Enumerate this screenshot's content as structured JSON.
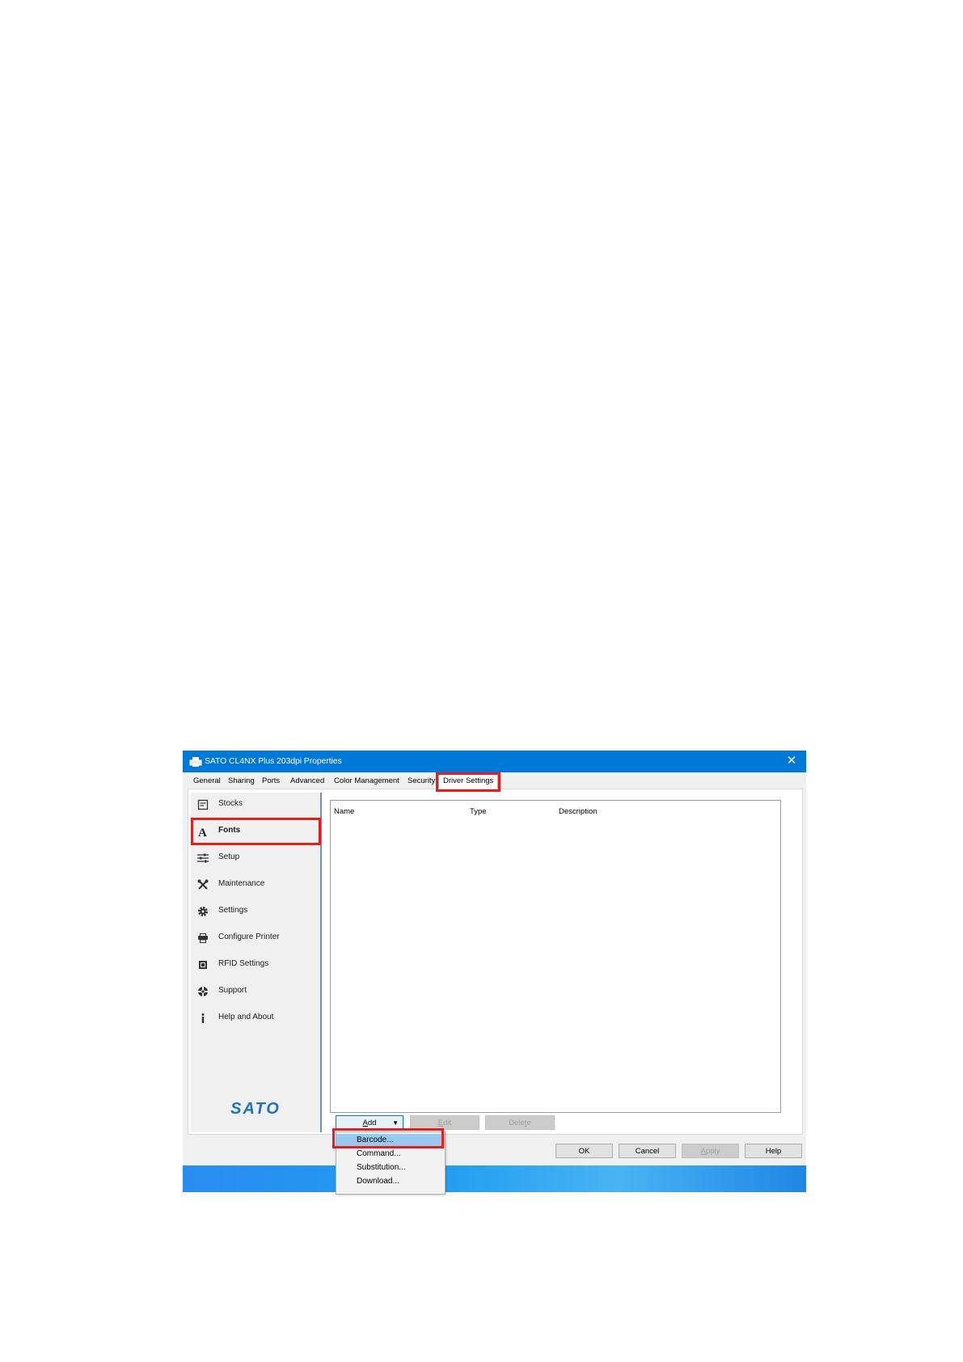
{
  "window": {
    "title": "SATO CL4NX Plus 203dpi Properties",
    "close_glyph": "✕"
  },
  "tabs": [
    "General",
    "Sharing",
    "Ports",
    "Advanced",
    "Color Management",
    "Security",
    "Driver Settings"
  ],
  "active_tab": "Driver Settings",
  "sidebar": {
    "items": [
      {
        "label": "Stocks",
        "icon": "stocks-icon"
      },
      {
        "label": "Fonts",
        "icon": "font-icon"
      },
      {
        "label": "Setup",
        "icon": "sliders-icon"
      },
      {
        "label": "Maintenance",
        "icon": "tools-icon"
      },
      {
        "label": "Settings",
        "icon": "gear-icon"
      },
      {
        "label": "Configure Printer",
        "icon": "printer-config-icon"
      },
      {
        "label": "RFID Settings",
        "icon": "rfid-icon"
      },
      {
        "label": "Support",
        "icon": "support-icon"
      },
      {
        "label": "Help and About",
        "icon": "info-icon"
      }
    ],
    "active": "Fonts",
    "logo_text": "SATO"
  },
  "list": {
    "columns": [
      "Name",
      "Type",
      "Description"
    ]
  },
  "buttons": {
    "add_prefix": "A",
    "add_rest": "dd",
    "edit_prefix": "E",
    "edit_rest": "dit",
    "delete_prefix": "Dele",
    "delete_u": "t",
    "delete_rest": "e",
    "ok": "OK",
    "cancel": "Cancel",
    "apply_prefix": "A",
    "apply_rest": "pply",
    "help": "Help"
  },
  "add_menu": {
    "items": [
      "Barcode...",
      "Command...",
      "Substitution...",
      "Download..."
    ],
    "highlighted": "Barcode..."
  },
  "colors": {
    "titlebar": "#0078d7",
    "highlight": "#e02020",
    "menu_hover": "#99c9ef"
  }
}
